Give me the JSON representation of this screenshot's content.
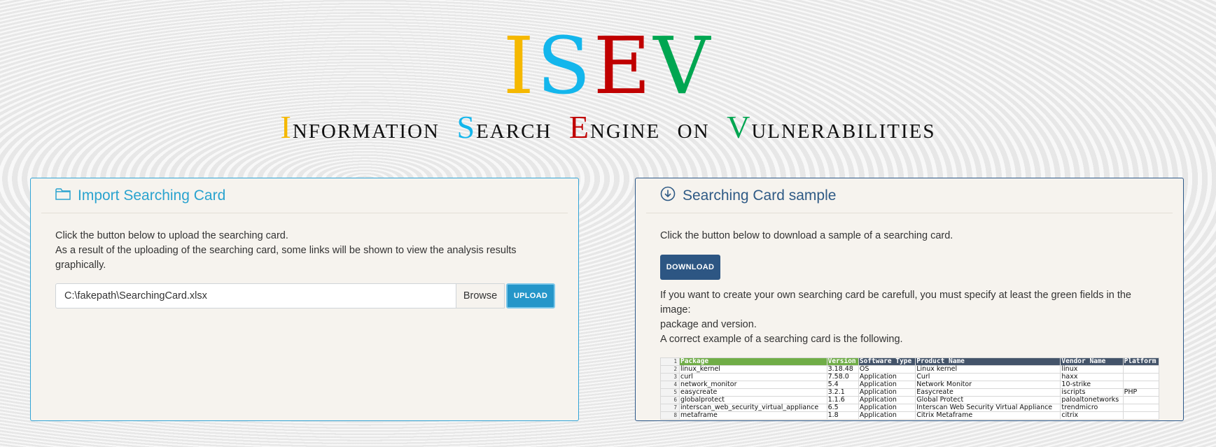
{
  "logo": {
    "letters": [
      "I",
      "S",
      "E",
      "V"
    ],
    "colors": [
      "#f5b800",
      "#13b6ec",
      "#c00000",
      "#00a651"
    ]
  },
  "tagline": {
    "words": [
      {
        "first": "I",
        "rest": "nformation",
        "color": "#f5b800"
      },
      {
        "first": "S",
        "rest": "earch",
        "color": "#13b6ec"
      },
      {
        "first": "E",
        "rest": "ngine",
        "color": "#c00000"
      },
      {
        "first": "o",
        "rest": "n",
        "color": "#111111"
      },
      {
        "first": "V",
        "rest": "ulnerabilities",
        "color": "#00a651"
      }
    ]
  },
  "import_card": {
    "icon": "folder-icon",
    "title": "Import Searching Card",
    "line1": "Click the button below to upload the searching card.",
    "line2": "As a result of the uploading of the searching card, some links will be shown to view the analysis results graphically.",
    "file_value": "C:\\fakepath\\SearchingCard.xlsx",
    "browse_label": "Browse",
    "upload_label": "UPLOAD"
  },
  "sample_card": {
    "icon": "download-circle-icon",
    "title": "Searching Card sample",
    "line1": "Click the button below to download a sample of a searching card.",
    "download_label": "DOWNLOAD",
    "note1": "If you want to create your own searching card be carefull, you must specify at least the green fields in the image:",
    "note2": "package and version.",
    "note3": "A correct example of a searching card is the following.",
    "table": {
      "headers": [
        "Package",
        "Version",
        "Software Type",
        "Product Name",
        "Vendor Name",
        "Platform"
      ],
      "rows": [
        [
          "linux_kernel",
          "3.18.48",
          "OS",
          "Linux kernel",
          "linux",
          ""
        ],
        [
          "curl",
          "7.58.0",
          "Application",
          "Curl",
          "haxx",
          ""
        ],
        [
          "network_monitor",
          "5.4",
          "Application",
          "Network Monitor",
          "10-strike",
          ""
        ],
        [
          "easycreate",
          "3.2.1",
          "Application",
          "Easycreate",
          "iscripts",
          "PHP"
        ],
        [
          "globalprotect",
          "1.1.6",
          "Application",
          "Global Protect",
          "paloaltonetworks",
          ""
        ],
        [
          "interscan_web_security_virtual_appliance",
          "6.5",
          "Application",
          "Interscan Web Security Virtual Appliance",
          "trendmicro",
          ""
        ],
        [
          "metaframe",
          "1.8",
          "Application",
          "Citrix Metaframe",
          "citrix",
          ""
        ]
      ]
    }
  }
}
